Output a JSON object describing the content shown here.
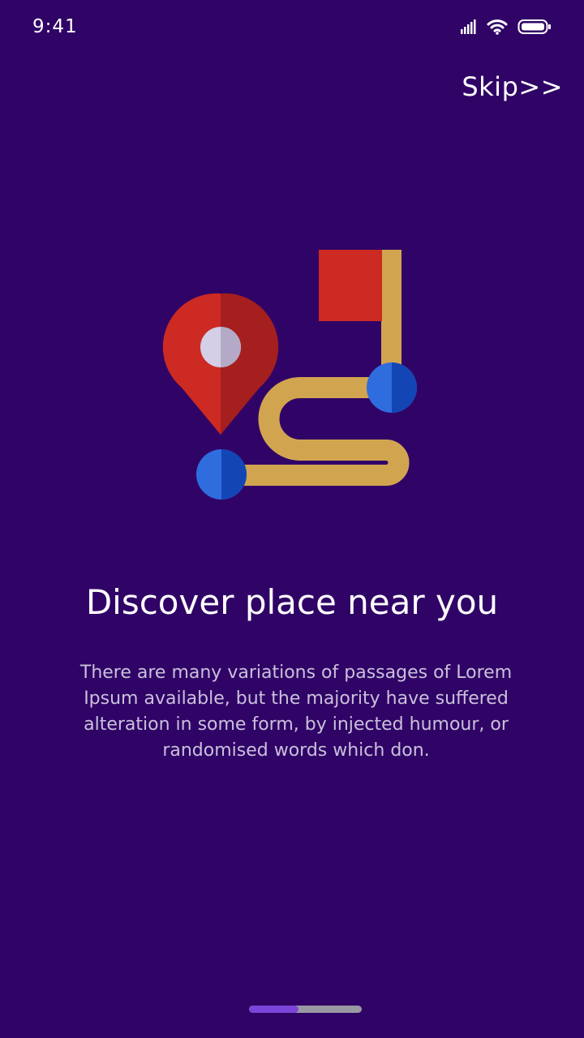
{
  "status_bar": {
    "time": "9:41",
    "icons": [
      "signal-icon",
      "wifi-icon",
      "battery-icon"
    ]
  },
  "header": {
    "skip_label": "Skip>>"
  },
  "onboarding": {
    "illustration": "map-route-icon",
    "title": "Discover place near you",
    "description": "There are many variations of passages of Lorem Ipsum available, but the majority have suffered alteration in some form, by injected humour, or randomised words which don."
  },
  "pager": {
    "progress": 0.44
  },
  "colors": {
    "background": "#300466",
    "pin_red": "#cc2a22",
    "path_gold": "#d1a54f",
    "dot_blue": "#2f6ddf",
    "pager_active": "#7b45d9",
    "pager_track": "#9a99a3"
  }
}
